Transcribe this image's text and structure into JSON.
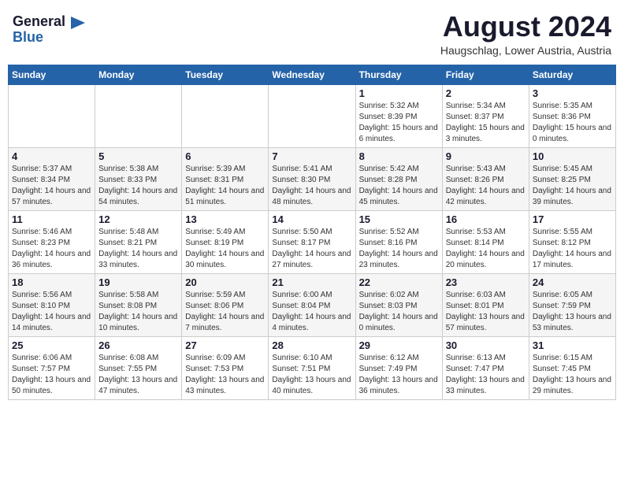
{
  "header": {
    "logo_general": "General",
    "logo_blue": "Blue",
    "title": "August 2024",
    "location": "Haugschlag, Lower Austria, Austria"
  },
  "weekdays": [
    "Sunday",
    "Monday",
    "Tuesday",
    "Wednesday",
    "Thursday",
    "Friday",
    "Saturday"
  ],
  "weeks": [
    [
      {
        "day": "",
        "sunrise": "",
        "sunset": "",
        "daylight": ""
      },
      {
        "day": "",
        "sunrise": "",
        "sunset": "",
        "daylight": ""
      },
      {
        "day": "",
        "sunrise": "",
        "sunset": "",
        "daylight": ""
      },
      {
        "day": "",
        "sunrise": "",
        "sunset": "",
        "daylight": ""
      },
      {
        "day": "1",
        "sunrise": "Sunrise: 5:32 AM",
        "sunset": "Sunset: 8:39 PM",
        "daylight": "Daylight: 15 hours and 6 minutes."
      },
      {
        "day": "2",
        "sunrise": "Sunrise: 5:34 AM",
        "sunset": "Sunset: 8:37 PM",
        "daylight": "Daylight: 15 hours and 3 minutes."
      },
      {
        "day": "3",
        "sunrise": "Sunrise: 5:35 AM",
        "sunset": "Sunset: 8:36 PM",
        "daylight": "Daylight: 15 hours and 0 minutes."
      }
    ],
    [
      {
        "day": "4",
        "sunrise": "Sunrise: 5:37 AM",
        "sunset": "Sunset: 8:34 PM",
        "daylight": "Daylight: 14 hours and 57 minutes."
      },
      {
        "day": "5",
        "sunrise": "Sunrise: 5:38 AM",
        "sunset": "Sunset: 8:33 PM",
        "daylight": "Daylight: 14 hours and 54 minutes."
      },
      {
        "day": "6",
        "sunrise": "Sunrise: 5:39 AM",
        "sunset": "Sunset: 8:31 PM",
        "daylight": "Daylight: 14 hours and 51 minutes."
      },
      {
        "day": "7",
        "sunrise": "Sunrise: 5:41 AM",
        "sunset": "Sunset: 8:30 PM",
        "daylight": "Daylight: 14 hours and 48 minutes."
      },
      {
        "day": "8",
        "sunrise": "Sunrise: 5:42 AM",
        "sunset": "Sunset: 8:28 PM",
        "daylight": "Daylight: 14 hours and 45 minutes."
      },
      {
        "day": "9",
        "sunrise": "Sunrise: 5:43 AM",
        "sunset": "Sunset: 8:26 PM",
        "daylight": "Daylight: 14 hours and 42 minutes."
      },
      {
        "day": "10",
        "sunrise": "Sunrise: 5:45 AM",
        "sunset": "Sunset: 8:25 PM",
        "daylight": "Daylight: 14 hours and 39 minutes."
      }
    ],
    [
      {
        "day": "11",
        "sunrise": "Sunrise: 5:46 AM",
        "sunset": "Sunset: 8:23 PM",
        "daylight": "Daylight: 14 hours and 36 minutes."
      },
      {
        "day": "12",
        "sunrise": "Sunrise: 5:48 AM",
        "sunset": "Sunset: 8:21 PM",
        "daylight": "Daylight: 14 hours and 33 minutes."
      },
      {
        "day": "13",
        "sunrise": "Sunrise: 5:49 AM",
        "sunset": "Sunset: 8:19 PM",
        "daylight": "Daylight: 14 hours and 30 minutes."
      },
      {
        "day": "14",
        "sunrise": "Sunrise: 5:50 AM",
        "sunset": "Sunset: 8:17 PM",
        "daylight": "Daylight: 14 hours and 27 minutes."
      },
      {
        "day": "15",
        "sunrise": "Sunrise: 5:52 AM",
        "sunset": "Sunset: 8:16 PM",
        "daylight": "Daylight: 14 hours and 23 minutes."
      },
      {
        "day": "16",
        "sunrise": "Sunrise: 5:53 AM",
        "sunset": "Sunset: 8:14 PM",
        "daylight": "Daylight: 14 hours and 20 minutes."
      },
      {
        "day": "17",
        "sunrise": "Sunrise: 5:55 AM",
        "sunset": "Sunset: 8:12 PM",
        "daylight": "Daylight: 14 hours and 17 minutes."
      }
    ],
    [
      {
        "day": "18",
        "sunrise": "Sunrise: 5:56 AM",
        "sunset": "Sunset: 8:10 PM",
        "daylight": "Daylight: 14 hours and 14 minutes."
      },
      {
        "day": "19",
        "sunrise": "Sunrise: 5:58 AM",
        "sunset": "Sunset: 8:08 PM",
        "daylight": "Daylight: 14 hours and 10 minutes."
      },
      {
        "day": "20",
        "sunrise": "Sunrise: 5:59 AM",
        "sunset": "Sunset: 8:06 PM",
        "daylight": "Daylight: 14 hours and 7 minutes."
      },
      {
        "day": "21",
        "sunrise": "Sunrise: 6:00 AM",
        "sunset": "Sunset: 8:04 PM",
        "daylight": "Daylight: 14 hours and 4 minutes."
      },
      {
        "day": "22",
        "sunrise": "Sunrise: 6:02 AM",
        "sunset": "Sunset: 8:03 PM",
        "daylight": "Daylight: 14 hours and 0 minutes."
      },
      {
        "day": "23",
        "sunrise": "Sunrise: 6:03 AM",
        "sunset": "Sunset: 8:01 PM",
        "daylight": "Daylight: 13 hours and 57 minutes."
      },
      {
        "day": "24",
        "sunrise": "Sunrise: 6:05 AM",
        "sunset": "Sunset: 7:59 PM",
        "daylight": "Daylight: 13 hours and 53 minutes."
      }
    ],
    [
      {
        "day": "25",
        "sunrise": "Sunrise: 6:06 AM",
        "sunset": "Sunset: 7:57 PM",
        "daylight": "Daylight: 13 hours and 50 minutes."
      },
      {
        "day": "26",
        "sunrise": "Sunrise: 6:08 AM",
        "sunset": "Sunset: 7:55 PM",
        "daylight": "Daylight: 13 hours and 47 minutes."
      },
      {
        "day": "27",
        "sunrise": "Sunrise: 6:09 AM",
        "sunset": "Sunset: 7:53 PM",
        "daylight": "Daylight: 13 hours and 43 minutes."
      },
      {
        "day": "28",
        "sunrise": "Sunrise: 6:10 AM",
        "sunset": "Sunset: 7:51 PM",
        "daylight": "Daylight: 13 hours and 40 minutes."
      },
      {
        "day": "29",
        "sunrise": "Sunrise: 6:12 AM",
        "sunset": "Sunset: 7:49 PM",
        "daylight": "Daylight: 13 hours and 36 minutes."
      },
      {
        "day": "30",
        "sunrise": "Sunrise: 6:13 AM",
        "sunset": "Sunset: 7:47 PM",
        "daylight": "Daylight: 13 hours and 33 minutes."
      },
      {
        "day": "31",
        "sunrise": "Sunrise: 6:15 AM",
        "sunset": "Sunset: 7:45 PM",
        "daylight": "Daylight: 13 hours and 29 minutes."
      }
    ]
  ]
}
